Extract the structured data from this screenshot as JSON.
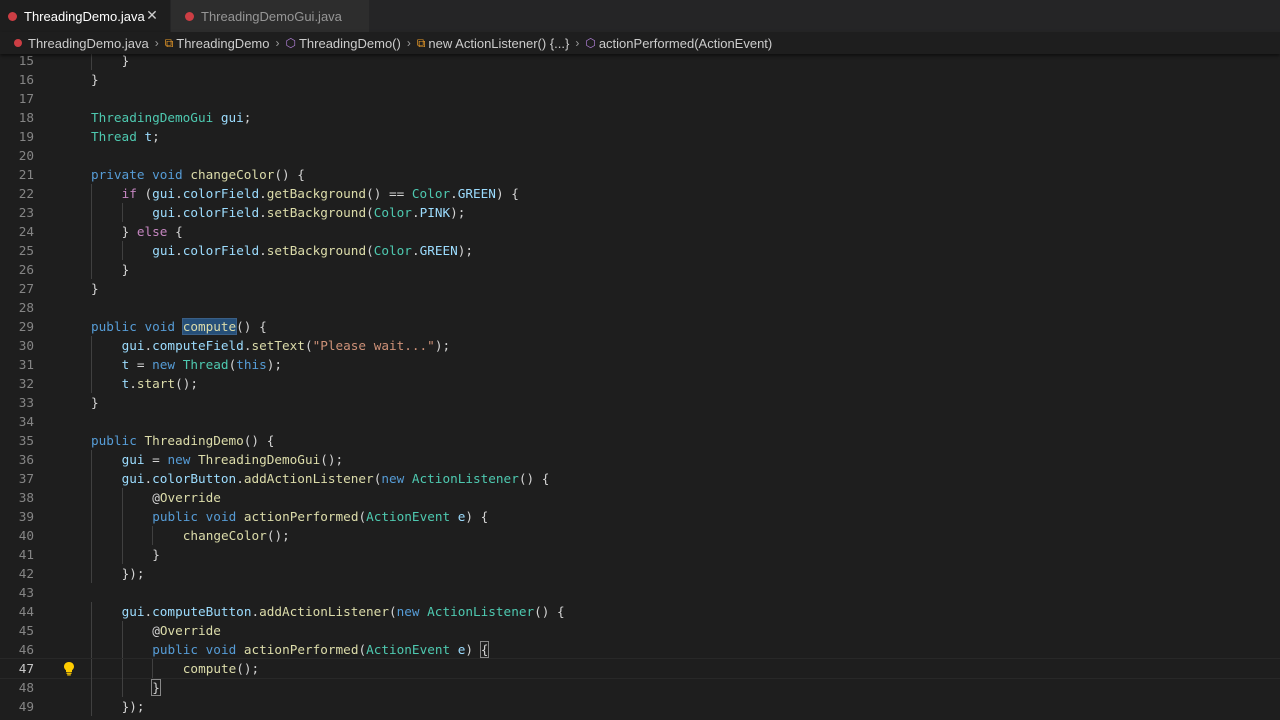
{
  "tabs": [
    {
      "label": "ThreadingDemo.java",
      "active": true,
      "icon": "java-file-icon"
    },
    {
      "label": "ThreadingDemoGui.java",
      "active": false,
      "icon": "java-file-icon"
    }
  ],
  "close_glyph": "✕",
  "breadcrumb": [
    {
      "label": "ThreadingDemo.java",
      "icon": "java-file-icon"
    },
    {
      "label": "ThreadingDemo",
      "icon": "class-symbol-icon"
    },
    {
      "label": "ThreadingDemo()",
      "icon": "method-symbol-icon"
    },
    {
      "label": "new ActionListener() {...}",
      "icon": "class-symbol-icon"
    },
    {
      "label": "actionPerformed(ActionEvent)",
      "icon": "method-symbol-icon"
    }
  ],
  "colors": {
    "background": "#1e1e1e",
    "keyword": "#569cd6",
    "control": "#c586c0",
    "type": "#4ec9b0",
    "function": "#dcdcaa",
    "variable": "#9cdcfe",
    "string": "#ce9178",
    "selection": "#264f78",
    "java_icon": "#cc3e44"
  },
  "current_line": 47,
  "lines": [
    {
      "n": "15",
      "indent": 1,
      "tokens": [
        [
          "p",
          "}"
        ]
      ]
    },
    {
      "n": "16",
      "indent": 0,
      "tokens": [
        [
          "p",
          "}"
        ]
      ]
    },
    {
      "n": "17",
      "indent": 0,
      "tokens": []
    },
    {
      "n": "18",
      "indent": 0,
      "tokens": [
        [
          "typ",
          "ThreadingDemoGui"
        ],
        [
          "p",
          " "
        ],
        [
          "var",
          "gui"
        ],
        [
          "p",
          ";"
        ]
      ]
    },
    {
      "n": "19",
      "indent": 0,
      "tokens": [
        [
          "typ",
          "Thread"
        ],
        [
          "p",
          " "
        ],
        [
          "var",
          "t"
        ],
        [
          "p",
          ";"
        ]
      ]
    },
    {
      "n": "20",
      "indent": 0,
      "tokens": []
    },
    {
      "n": "21",
      "indent": 0,
      "tokens": [
        [
          "kw",
          "private"
        ],
        [
          "p",
          " "
        ],
        [
          "kw",
          "void"
        ],
        [
          "p",
          " "
        ],
        [
          "fn",
          "changeColor"
        ],
        [
          "p",
          "() {"
        ]
      ]
    },
    {
      "n": "22",
      "indent": 1,
      "tokens": [
        [
          "kw2",
          "if"
        ],
        [
          "p",
          " ("
        ],
        [
          "var",
          "gui"
        ],
        [
          "p",
          "."
        ],
        [
          "var",
          "colorField"
        ],
        [
          "p",
          "."
        ],
        [
          "fn",
          "getBackground"
        ],
        [
          "p",
          "() == "
        ],
        [
          "typ",
          "Color"
        ],
        [
          "p",
          "."
        ],
        [
          "var",
          "GREEN"
        ],
        [
          "p",
          ") {"
        ]
      ]
    },
    {
      "n": "23",
      "indent": 2,
      "tokens": [
        [
          "var",
          "gui"
        ],
        [
          "p",
          "."
        ],
        [
          "var",
          "colorField"
        ],
        [
          "p",
          "."
        ],
        [
          "fn",
          "setBackground"
        ],
        [
          "p",
          "("
        ],
        [
          "typ",
          "Color"
        ],
        [
          "p",
          "."
        ],
        [
          "var",
          "PINK"
        ],
        [
          "p",
          ");"
        ]
      ]
    },
    {
      "n": "24",
      "indent": 1,
      "tokens": [
        [
          "p",
          "} "
        ],
        [
          "kw2",
          "else"
        ],
        [
          "p",
          " {"
        ]
      ]
    },
    {
      "n": "25",
      "indent": 2,
      "tokens": [
        [
          "var",
          "gui"
        ],
        [
          "p",
          "."
        ],
        [
          "var",
          "colorField"
        ],
        [
          "p",
          "."
        ],
        [
          "fn",
          "setBackground"
        ],
        [
          "p",
          "("
        ],
        [
          "typ",
          "Color"
        ],
        [
          "p",
          "."
        ],
        [
          "var",
          "GREEN"
        ],
        [
          "p",
          ");"
        ]
      ]
    },
    {
      "n": "26",
      "indent": 1,
      "tokens": [
        [
          "p",
          "}"
        ]
      ]
    },
    {
      "n": "27",
      "indent": 0,
      "tokens": [
        [
          "p",
          "}"
        ]
      ]
    },
    {
      "n": "28",
      "indent": 0,
      "tokens": []
    },
    {
      "n": "29",
      "indent": 0,
      "tokens": [
        [
          "kw",
          "public"
        ],
        [
          "p",
          " "
        ],
        [
          "kw",
          "void"
        ],
        [
          "p",
          " "
        ],
        [
          "fnhl",
          "compute"
        ],
        [
          "p",
          "() {"
        ]
      ]
    },
    {
      "n": "30",
      "indent": 1,
      "tokens": [
        [
          "var",
          "gui"
        ],
        [
          "p",
          "."
        ],
        [
          "var",
          "computeField"
        ],
        [
          "p",
          "."
        ],
        [
          "fn",
          "setText"
        ],
        [
          "p",
          "("
        ],
        [
          "str",
          "\"Please wait...\""
        ],
        [
          "p",
          ");"
        ]
      ]
    },
    {
      "n": "31",
      "indent": 1,
      "tokens": [
        [
          "var",
          "t"
        ],
        [
          "p",
          " = "
        ],
        [
          "kw",
          "new"
        ],
        [
          "p",
          " "
        ],
        [
          "typ",
          "Thread"
        ],
        [
          "p",
          "("
        ],
        [
          "kw",
          "this"
        ],
        [
          "p",
          ");"
        ]
      ]
    },
    {
      "n": "32",
      "indent": 1,
      "tokens": [
        [
          "var",
          "t"
        ],
        [
          "p",
          "."
        ],
        [
          "fn",
          "start"
        ],
        [
          "p",
          "();"
        ]
      ]
    },
    {
      "n": "33",
      "indent": 0,
      "tokens": [
        [
          "p",
          "}"
        ]
      ]
    },
    {
      "n": "34",
      "indent": 0,
      "tokens": []
    },
    {
      "n": "35",
      "indent": 0,
      "tokens": [
        [
          "kw",
          "public"
        ],
        [
          "p",
          " "
        ],
        [
          "fn",
          "ThreadingDemo"
        ],
        [
          "p",
          "() {"
        ]
      ]
    },
    {
      "n": "36",
      "indent": 1,
      "tokens": [
        [
          "var",
          "gui"
        ],
        [
          "p",
          " = "
        ],
        [
          "kw",
          "new"
        ],
        [
          "p",
          " "
        ],
        [
          "fn",
          "ThreadingDemoGui"
        ],
        [
          "p",
          "();"
        ]
      ]
    },
    {
      "n": "37",
      "indent": 1,
      "tokens": [
        [
          "var",
          "gui"
        ],
        [
          "p",
          "."
        ],
        [
          "var",
          "colorButton"
        ],
        [
          "p",
          "."
        ],
        [
          "fn",
          "addActionListener"
        ],
        [
          "p",
          "("
        ],
        [
          "kw",
          "new"
        ],
        [
          "p",
          " "
        ],
        [
          "typ",
          "ActionListener"
        ],
        [
          "p",
          "() {"
        ]
      ]
    },
    {
      "n": "38",
      "indent": 2,
      "tokens": [
        [
          "p",
          "@"
        ],
        [
          "ann",
          "Override"
        ]
      ]
    },
    {
      "n": "39",
      "indent": 2,
      "tokens": [
        [
          "kw",
          "public"
        ],
        [
          "p",
          " "
        ],
        [
          "kw",
          "void"
        ],
        [
          "p",
          " "
        ],
        [
          "fn",
          "actionPerformed"
        ],
        [
          "p",
          "("
        ],
        [
          "typ",
          "ActionEvent"
        ],
        [
          "p",
          " "
        ],
        [
          "var",
          "e"
        ],
        [
          "p",
          ") {"
        ]
      ]
    },
    {
      "n": "40",
      "indent": 3,
      "tokens": [
        [
          "fn",
          "changeColor"
        ],
        [
          "p",
          "();"
        ]
      ]
    },
    {
      "n": "41",
      "indent": 2,
      "tokens": [
        [
          "p",
          "}"
        ]
      ]
    },
    {
      "n": "42",
      "indent": 1,
      "tokens": [
        [
          "p",
          "});"
        ]
      ]
    },
    {
      "n": "43",
      "indent": 0,
      "tokens": []
    },
    {
      "n": "44",
      "indent": 1,
      "tokens": [
        [
          "var",
          "gui"
        ],
        [
          "p",
          "."
        ],
        [
          "var",
          "computeButton"
        ],
        [
          "p",
          "."
        ],
        [
          "fn",
          "addActionListener"
        ],
        [
          "p",
          "("
        ],
        [
          "kw",
          "new"
        ],
        [
          "p",
          " "
        ],
        [
          "typ",
          "ActionListener"
        ],
        [
          "p",
          "() {"
        ]
      ]
    },
    {
      "n": "45",
      "indent": 2,
      "tokens": [
        [
          "p",
          "@"
        ],
        [
          "ann",
          "Override"
        ]
      ]
    },
    {
      "n": "46",
      "indent": 2,
      "tokens": [
        [
          "kw",
          "public"
        ],
        [
          "p",
          " "
        ],
        [
          "kw",
          "void"
        ],
        [
          "p",
          " "
        ],
        [
          "fn",
          "actionPerformed"
        ],
        [
          "p",
          "("
        ],
        [
          "typ",
          "ActionEvent"
        ],
        [
          "p",
          " "
        ],
        [
          "var",
          "e"
        ],
        [
          "p",
          ") "
        ],
        [
          "bm",
          "{"
        ]
      ]
    },
    {
      "n": "47",
      "indent": 3,
      "tokens": [
        [
          "fn",
          "compute"
        ],
        [
          "p",
          "();"
        ]
      ]
    },
    {
      "n": "48",
      "indent": 2,
      "tokens": [
        [
          "bm",
          "}"
        ]
      ]
    },
    {
      "n": "49",
      "indent": 1,
      "tokens": [
        [
          "p",
          "});"
        ]
      ]
    }
  ]
}
